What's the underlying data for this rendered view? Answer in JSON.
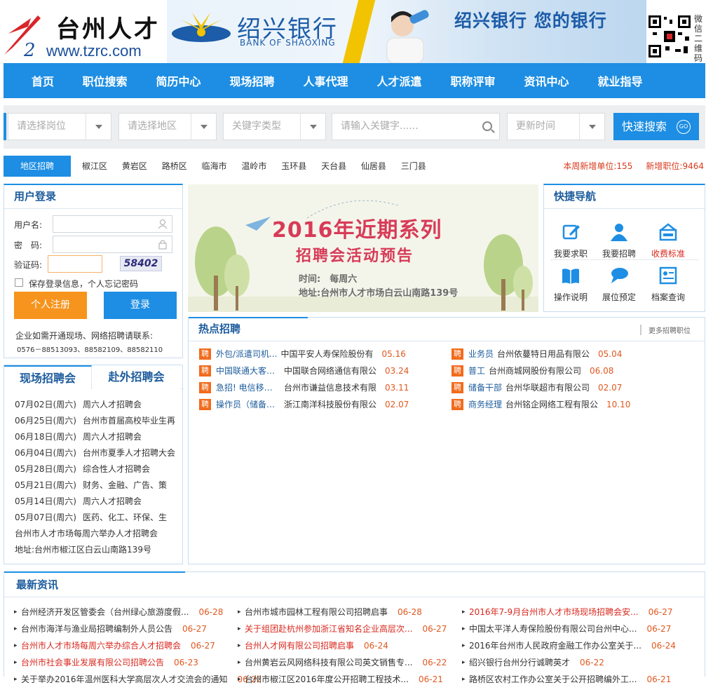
{
  "header": {
    "site_name": "台州人才",
    "site_url": "www.tzrc.com",
    "banner": {
      "bank_name_cn": "绍兴银行",
      "bank_name_en": "BANK OF SHAOXING",
      "slogan": "绍兴银行 您的银行"
    },
    "qr_label": "微信二维码"
  },
  "nav": {
    "items": [
      "首页",
      "职位搜索",
      "简历中心",
      "现场招聘",
      "人事代理",
      "人才派遣",
      "职称评审",
      "资讯中心",
      "就业指导"
    ]
  },
  "search": {
    "position_placeholder": "请选择岗位",
    "region_placeholder": "请选择地区",
    "keyword_type_placeholder": "关键字类型",
    "keyword_placeholder": "请输入关键字......",
    "time_placeholder": "更新时间",
    "button_label": "快速搜索",
    "go_label": "GO"
  },
  "region": {
    "tab_label": "地区招聘",
    "areas": [
      "椒江区",
      "黄岩区",
      "路桥区",
      "临海市",
      "温岭市",
      "玉环县",
      "天台县",
      "仙居县",
      "三门县"
    ],
    "weekly_units": "本周新增单位:155",
    "new_jobs": "新增职位:9464"
  },
  "login": {
    "title": "用户登录",
    "username_label": "用户名:",
    "password_label": "密　码:",
    "captcha_label": "验证码:",
    "captcha_code": "58402",
    "remember_label": "保存登录信息，个人忘记密码",
    "register_label": "个人注册",
    "login_label": "登录",
    "contact_note": "企业如需开通现场、网络招聘请联系:",
    "contact_phones": "0576－88513093、88582109、88582110"
  },
  "fairs": {
    "tabs": [
      "现场招聘会",
      "赴外招聘会"
    ],
    "rows": [
      {
        "date": "07月02日(周六)",
        "title": "周六人才招聘会"
      },
      {
        "date": "06月25日(周六)",
        "title": "台州市首届高校毕业生再"
      },
      {
        "date": "06月18日(周六)",
        "title": "周六人才招聘会"
      },
      {
        "date": "06月04日(周六)",
        "title": "台州市夏季人才招聘大会"
      },
      {
        "date": "05月28日(周六)",
        "title": "综合性人才招聘会"
      },
      {
        "date": "05月21日(周六)",
        "title": "财务、金融、广告、策"
      },
      {
        "date": "05月14日(周六)",
        "title": "周六人才招聘会"
      },
      {
        "date": "05月07日(周六)",
        "title": "医药、化工、环保、生"
      }
    ],
    "note": "台州市人才市场每周六举办人才招聘会",
    "address": "地址:台州市椒江区白云山南路139号"
  },
  "promo": {
    "headline": "2016年近期系列",
    "subline": "招聘会活动预告",
    "time_line": "时间:　每周六",
    "address_line": "地址:台州市人才市场白云山南路139号"
  },
  "quick_nav": {
    "title": "快捷导航",
    "items": [
      {
        "label": "我要求职",
        "icon": "edit-icon"
      },
      {
        "label": "我要招聘",
        "icon": "user-icon"
      },
      {
        "label": "收费标准",
        "icon": "fee-icon"
      },
      {
        "label": "操作说明",
        "icon": "book-icon"
      },
      {
        "label": "展位预定",
        "icon": "chat-icon"
      },
      {
        "label": "档案查询",
        "icon": "file-icon"
      }
    ]
  },
  "hot_jobs": {
    "title": "热点招聘",
    "more_label": "更多招聘职位",
    "tag": "聘",
    "left": [
      {
        "job": "外包/派遣司机...",
        "company": "中国平安人寿保险股份有",
        "date": "05.16"
      },
      {
        "job": "中国联通大客户...",
        "company": "中国联合网络通信有限公",
        "date": "03.24"
      },
      {
        "job": "急招! 电信移动...",
        "company": "台州市谦益信息技术有限",
        "date": "03.11"
      },
      {
        "job": "操作员（储备人...",
        "company": "浙江南洋科技股份有限公",
        "date": "02.07"
      }
    ],
    "right": [
      {
        "job": "业务员",
        "company": "台州依蔓特日用品有限公",
        "date": "05.04"
      },
      {
        "job": "普工",
        "company": "台州商城网股份有限公司",
        "date": "06.08"
      },
      {
        "job": "储备干部",
        "company": "台州华联超市有限公司",
        "date": "02.07"
      },
      {
        "job": "商务经理",
        "company": "台州铭企网络工程有限公",
        "date": "10.10"
      }
    ]
  },
  "news": {
    "title": "最新资讯",
    "columns": [
      [
        {
          "text": "台州经济开发区管委会（台州绿心旅游度假...",
          "date": "06-28",
          "red": false
        },
        {
          "text": "台州市海洋与渔业局招聘编制外人员公告",
          "date": "06-27",
          "red": false
        },
        {
          "text": "台州市人才市场每周六举办综合人才招聘会",
          "date": "06-27",
          "red": true
        },
        {
          "text": "台州市社会事业发展有限公司招聘公告",
          "date": "06-23",
          "red": true
        },
        {
          "text": "关于举办2016年温州医科大学高层次人才交流会的通知",
          "date": "06-22",
          "red": false
        }
      ],
      [
        {
          "text": "台州市城市园林工程有限公司招聘启事",
          "date": "06-28",
          "red": false
        },
        {
          "text": "关于组团赴杭州参加浙江省知名企业高层次...",
          "date": "06-27",
          "red": true
        },
        {
          "text": "台州人才网有限公司招聘启事",
          "date": "06-24",
          "red": true
        },
        {
          "text": "台州黄岩云风网络科技有限公司英文销售专...",
          "date": "06-22",
          "red": false
        },
        {
          "text": "台州市椒江区2016年度公开招聘工程技术...",
          "date": "06-21",
          "red": false
        }
      ],
      [
        {
          "text": "2016年7-9月台州市人才市场现场招聘会安...",
          "date": "06-27",
          "red": true
        },
        {
          "text": "中国太平洋人寿保险股份有限公司台州中心...",
          "date": "06-27",
          "red": false
        },
        {
          "text": "2016年台州市人民政府金融工作办公室关于...",
          "date": "06-24",
          "red": false
        },
        {
          "text": "绍兴银行台州分行诚聘英才",
          "date": "06-22",
          "red": false
        },
        {
          "text": "路桥区农村工作办公室关于公开招聘编外工...",
          "date": "06-21",
          "red": false
        }
      ]
    ]
  },
  "colors": {
    "primary": "#1d8ee3",
    "orange": "#f7941d",
    "accent_red": "#d93a1e",
    "heading_blue": "#1d5c9d"
  }
}
